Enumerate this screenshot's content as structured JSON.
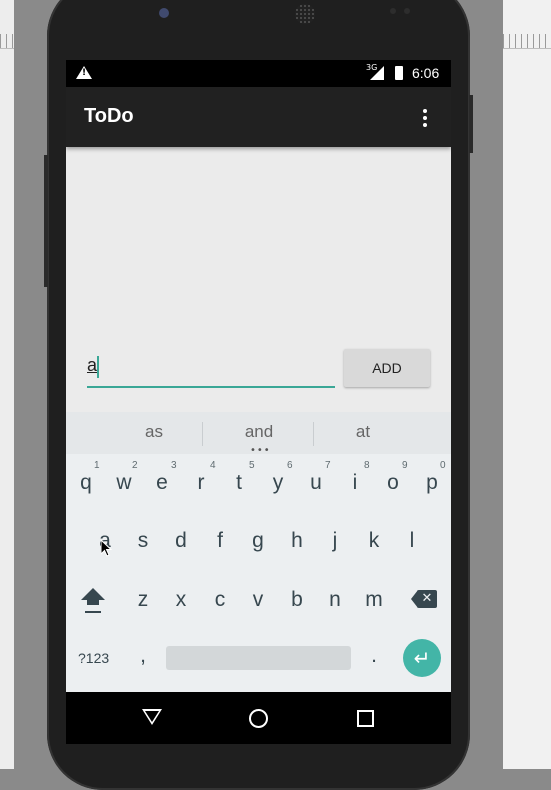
{
  "app": {
    "title": "ToDo"
  },
  "status_bar": {
    "time": "6:06",
    "network_label": "3G",
    "warning_icon": "warning-icon",
    "signal_icon": "signal-icon",
    "battery_icon": "battery-icon"
  },
  "task_input": {
    "value": "a"
  },
  "add_button": {
    "label": "ADD"
  },
  "suggestions": [
    "as",
    "and",
    "at"
  ],
  "keyboard": {
    "row1": [
      "q",
      "w",
      "e",
      "r",
      "t",
      "y",
      "u",
      "i",
      "o",
      "p"
    ],
    "row1_hints": [
      "1",
      "2",
      "3",
      "4",
      "5",
      "6",
      "7",
      "8",
      "9",
      "0"
    ],
    "row2": [
      "a",
      "s",
      "d",
      "f",
      "g",
      "h",
      "j",
      "k",
      "l"
    ],
    "row3": [
      "z",
      "x",
      "c",
      "v",
      "b",
      "n",
      "m"
    ],
    "symbols_label": "?123",
    "comma": ",",
    "period": "."
  },
  "colors": {
    "accent": "#43b5a7",
    "appbar": "#212121",
    "keyboard_bg": "#eceff1"
  }
}
